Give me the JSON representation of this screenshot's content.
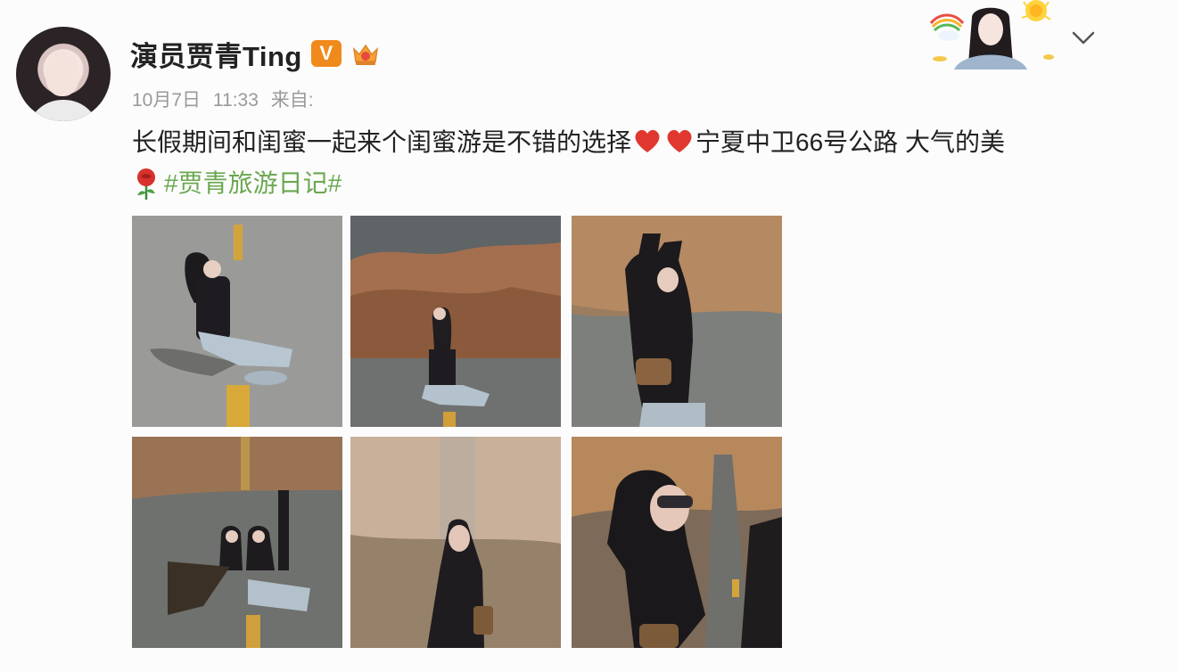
{
  "post": {
    "username": "演员贾青Ting",
    "vip_badge": "V",
    "date": "10月7日",
    "time": "11:33",
    "source_label": "来自:",
    "text_part1": "长假期间和闺蜜一起来个闺蜜游是不错的选择",
    "text_part2": "宁夏中卫66号公路 大气的美",
    "hashtag": "#贾青旅游日记#",
    "photos": [
      {
        "name": "photo-1"
      },
      {
        "name": "photo-2"
      },
      {
        "name": "photo-3"
      },
      {
        "name": "photo-4"
      },
      {
        "name": "photo-5"
      },
      {
        "name": "photo-6"
      }
    ]
  },
  "icons": {
    "verified": "verified-v-badge",
    "crown": "crown-icon",
    "heart": "heart-icon",
    "rose": "rose-icon",
    "more": "chevron-down-icon"
  },
  "colors": {
    "hashtag": "#6aa84f",
    "vip": "#f08a1d",
    "heart": "#e0382f",
    "meta": "#9a9a9a"
  }
}
